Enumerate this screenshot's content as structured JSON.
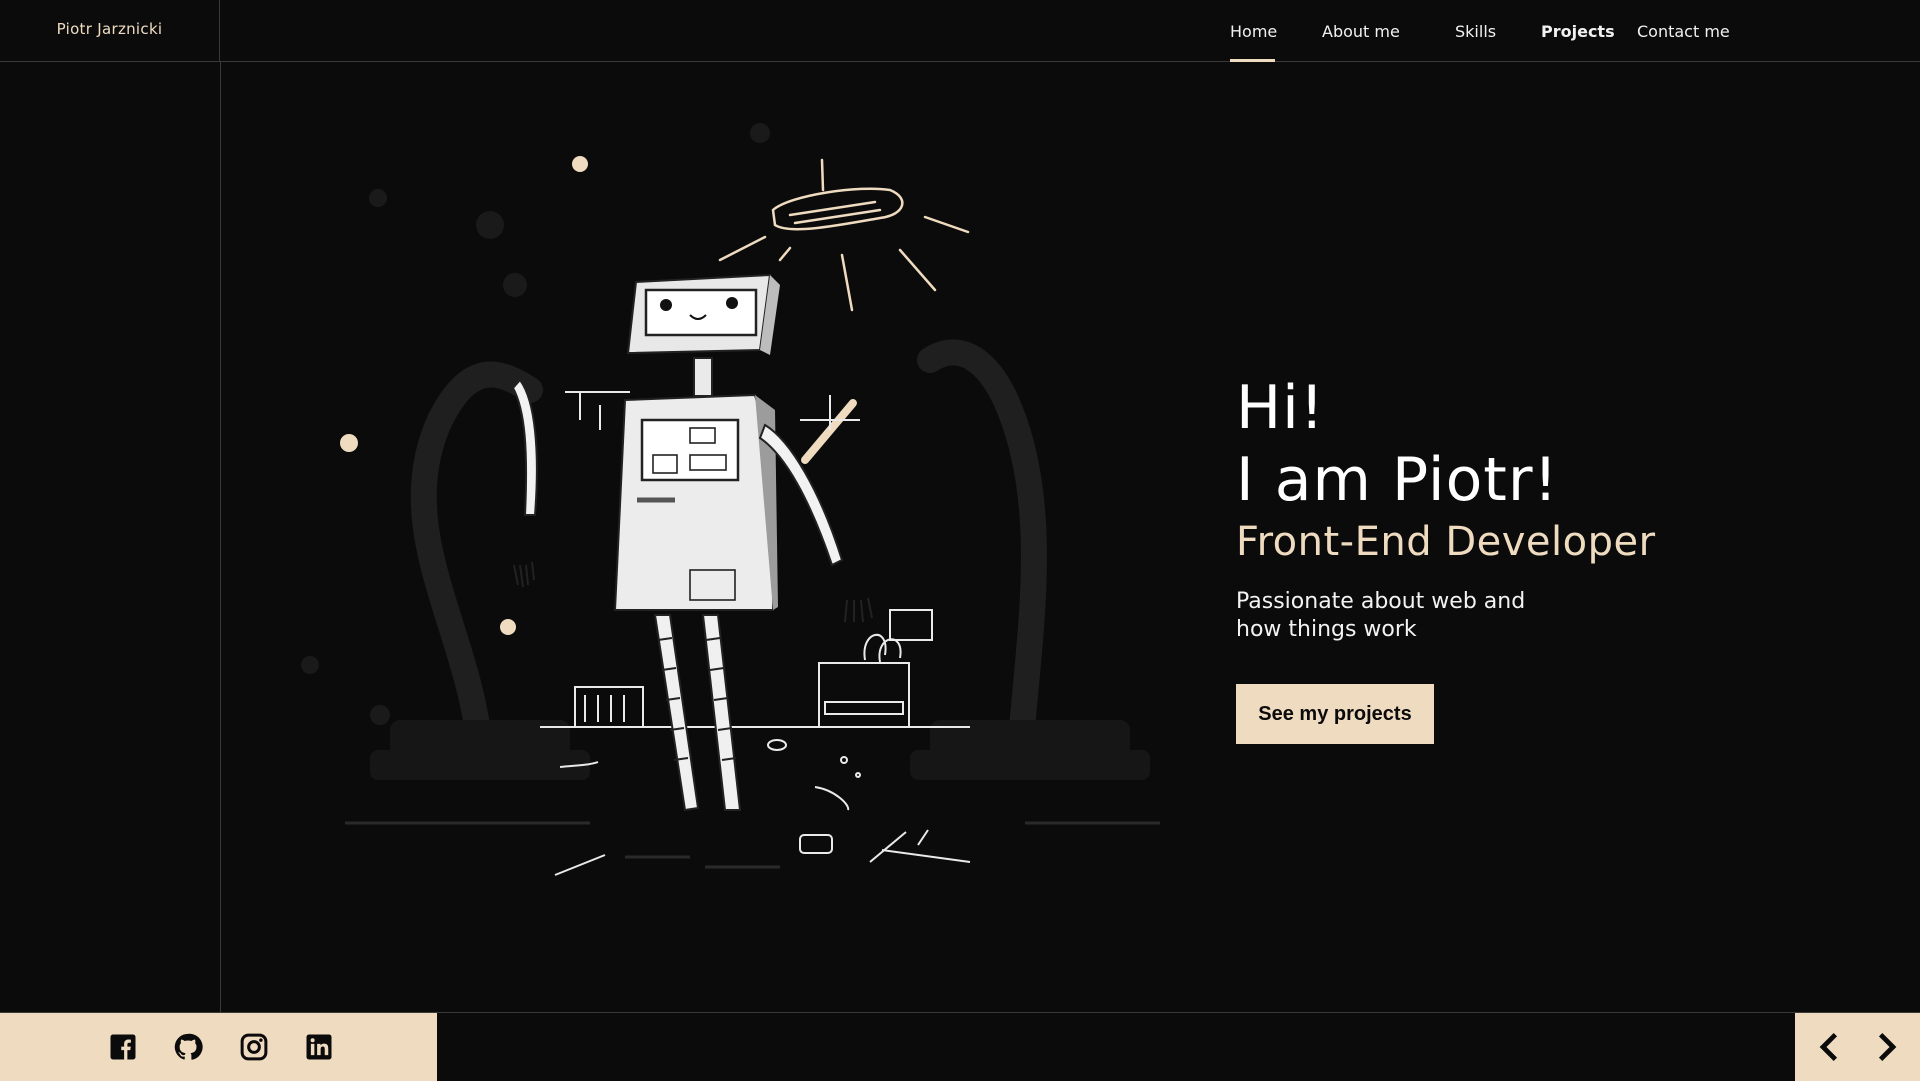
{
  "brand": {
    "name": "Piotr Jarznicki"
  },
  "nav": {
    "items": [
      {
        "label": "Home",
        "active": true
      },
      {
        "label": "About me"
      },
      {
        "label": "Skills"
      },
      {
        "label": "Projects"
      },
      {
        "label": "Contact me"
      }
    ]
  },
  "hero": {
    "line1": "Hi!",
    "line2": "I am Piotr!",
    "role": "Front-End Developer",
    "tagline": "Passionate about web and how things work",
    "cta": "See my projects"
  },
  "footer": {
    "social": [
      {
        "icon": "facebook-icon"
      },
      {
        "icon": "github-icon"
      },
      {
        "icon": "instagram-icon"
      },
      {
        "icon": "linkedin-icon"
      }
    ],
    "arrows": [
      {
        "icon": "chevron-left-icon"
      },
      {
        "icon": "chevron-right-icon"
      }
    ]
  },
  "colors": {
    "background": "#0c0b0c",
    "accent": "#efdcc0",
    "text": "#ffffff",
    "border": "#3a3a3a"
  }
}
